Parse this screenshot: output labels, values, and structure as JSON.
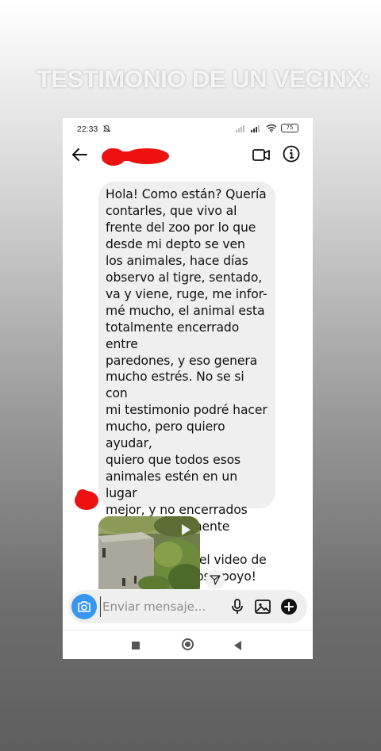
{
  "story": {
    "title": "TESTIMONIO DE UN VECINX:"
  },
  "status_bar": {
    "time": "22:33",
    "battery": "75"
  },
  "header": {
    "back_icon": "arrow-left-icon",
    "video_icon": "video-call-icon",
    "info_icon": "info-icon"
  },
  "message": {
    "text": "Hola! Como están? Quería\ncontarles, que vivo al\nfrente del zoo por lo que\ndesde mi depto se ven\nlos animales, hace días\nobservo al tigre, sentado,\nva y viene, ruge, me infor-\nmé mucho, el animal esta\ntotalmente encerrado entre\nparedones, y eso genera\nmucho estrés. No se si con\nmi testimonio podré hacer\nmucho, pero quiero ayudar,\nquiero que todos esos\nanimales estén en un lugar\nmejor, y no encerrados\ncomplementamente estre-\nsados, adjunto el video de\ndonde está, y los apoyo!"
  },
  "composer": {
    "placeholder": "Enviar mensaje...",
    "camera_icon": "camera-icon",
    "mic_icon": "microphone-icon",
    "gallery_icon": "image-icon",
    "add_icon": "plus-circle-icon"
  },
  "colors": {
    "accent": "#3797f0",
    "bubble": "#efefef",
    "redaction": "#ee1111"
  }
}
